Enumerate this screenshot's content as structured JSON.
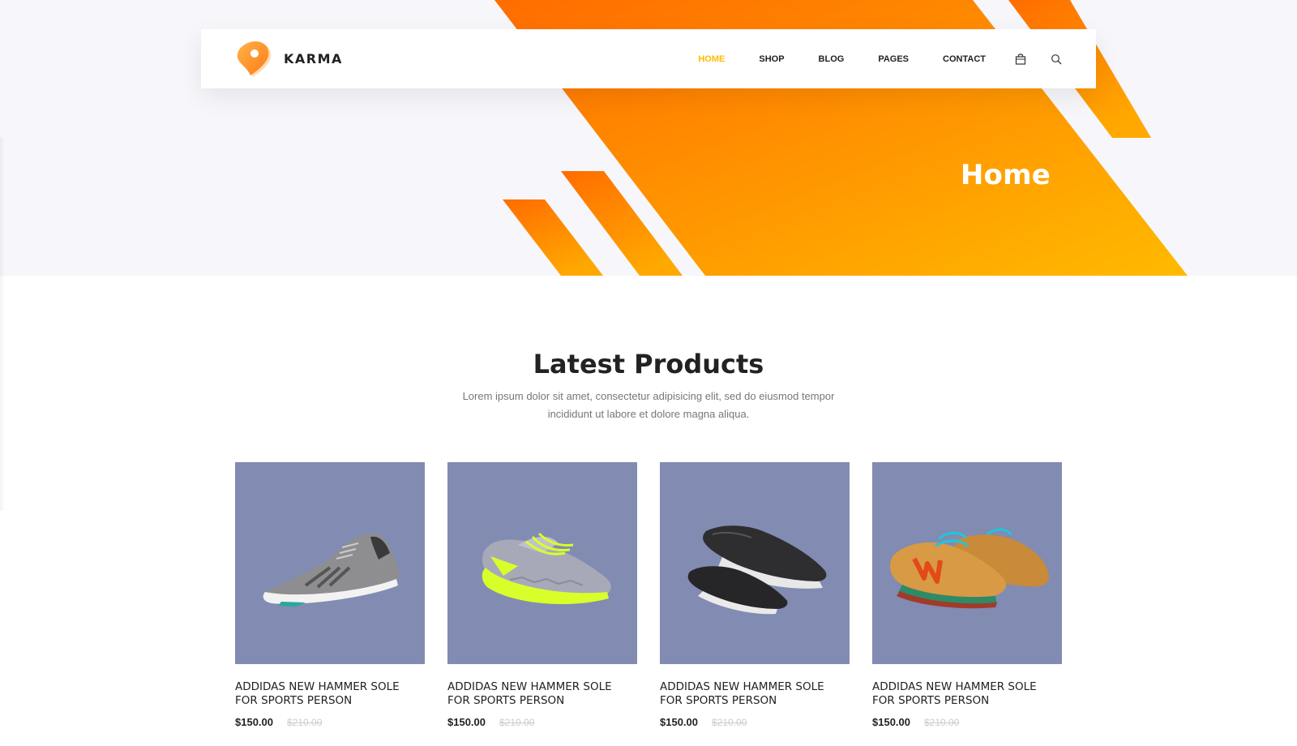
{
  "brand": {
    "name": "KARMA",
    "logo_icon": "location-pin-logo-icon"
  },
  "nav": {
    "items": [
      {
        "label": "HOME",
        "active": true
      },
      {
        "label": "SHOP",
        "active": false
      },
      {
        "label": "BLOG",
        "active": false
      },
      {
        "label": "PAGES",
        "active": false
      },
      {
        "label": "CONTACT",
        "active": false
      }
    ],
    "cart_icon": "shopping-bag-icon",
    "search_icon": "search-icon"
  },
  "banner": {
    "heading": "Home"
  },
  "section": {
    "title": "Latest Products",
    "subtitle": "Lorem ipsum dolor sit amet, consectetur adipisicing elit, sed do eiusmod tempor incididunt ut labore et dolore magna aliqua."
  },
  "products": [
    {
      "name": "ADDIDAS NEW HAMMER SOLE FOR SPORTS PERSON",
      "price": "$150.00",
      "old_price": "$210.00",
      "image": "grey-running-shoe"
    },
    {
      "name": "ADDIDAS NEW HAMMER SOLE FOR SPORTS PERSON",
      "price": "$150.00",
      "old_price": "$210.00",
      "image": "grey-neon-running-shoe"
    },
    {
      "name": "ADDIDAS NEW HAMMER SOLE FOR SPORTS PERSON",
      "price": "$150.00",
      "old_price": "$210.00",
      "image": "black-slip-on-shoes"
    },
    {
      "name": "ADDIDAS NEW HAMMER SOLE FOR SPORTS PERSON",
      "price": "$150.00",
      "old_price": "$210.00",
      "image": "tan-leather-sneakers"
    }
  ],
  "colors": {
    "accent": "#ffba00",
    "accent_dark": "#ff6c00",
    "product_bg": "#828bb2",
    "hero_bg": "#f7f7fb"
  }
}
